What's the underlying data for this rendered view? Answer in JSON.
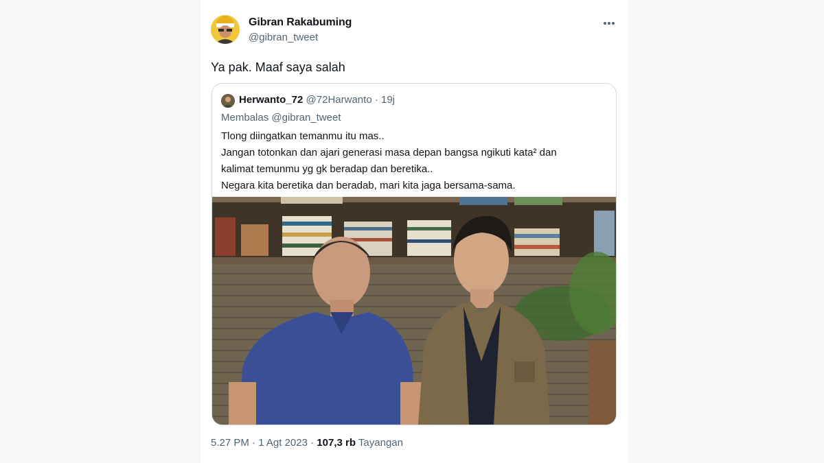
{
  "tweet": {
    "author_name": "Gibran Rakabuming",
    "author_handle": "@gibran_tweet",
    "text": "Ya pak. Maaf saya salah",
    "more_icon": "more-horizontal-icon"
  },
  "quoted": {
    "author_name": "Herwanto_72",
    "author_handle": "@72Harwanto",
    "separator": "·",
    "time": "19j",
    "reply_prefix": "Membalas",
    "reply_mention": "@gibran_tweet",
    "lines": [
      "Tlong diingatkan temanmu itu mas..",
      "Jangan totonkan dan ajari generasi masa depan bangsa  ngikuti kata² dan",
      "kalimat temunmu yg gk beradap dan beretika..",
      "Negara kita beretika dan beradab, mari kita jaga bersama-sama."
    ]
  },
  "meta": {
    "time": "5.27 PM",
    "separator": "·",
    "date": "1 Agt 2023",
    "views": "107,3 rb",
    "views_label": "Tayangan"
  }
}
